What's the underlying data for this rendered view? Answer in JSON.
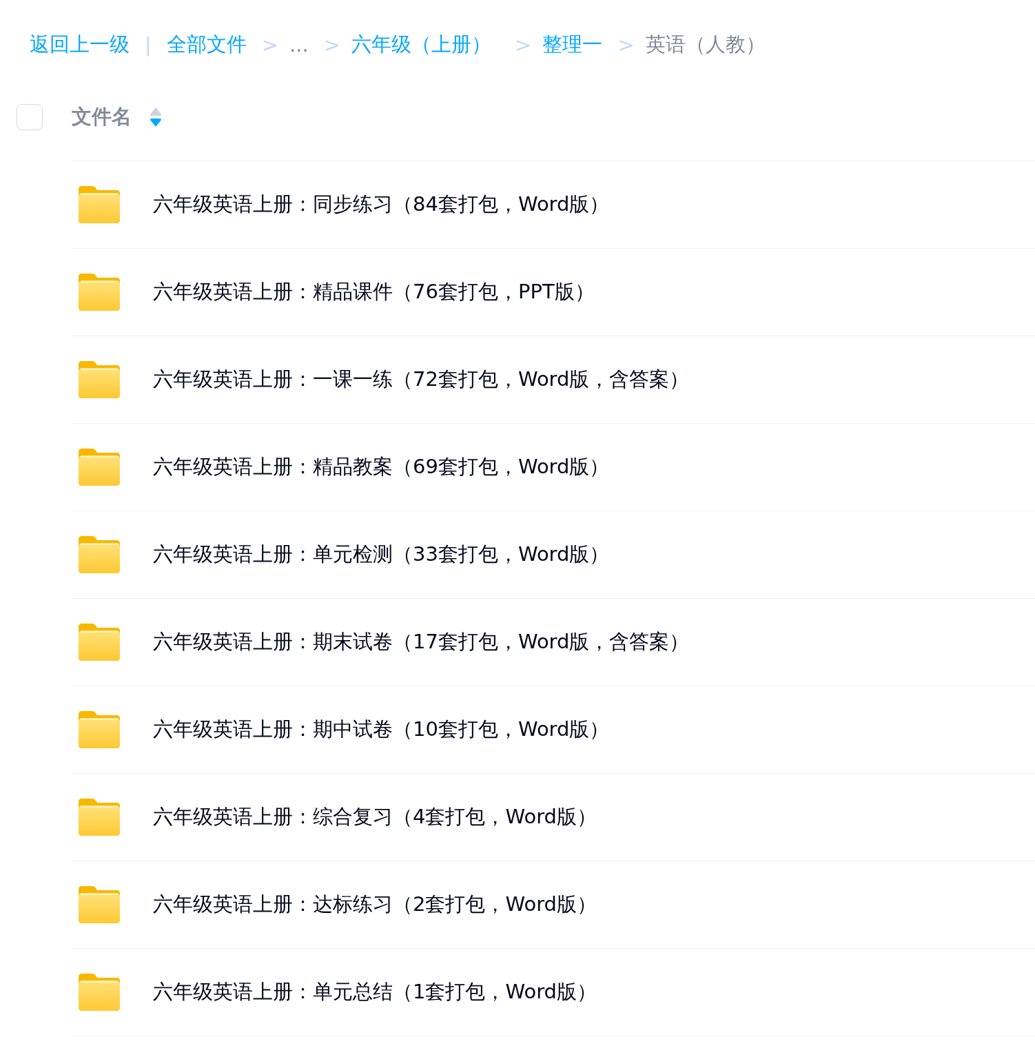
{
  "breadcrumb": [
    {
      "kind": "link",
      "text": "返回上一级"
    },
    {
      "kind": "divider",
      "text": "|"
    },
    {
      "kind": "link",
      "text": "全部文件"
    },
    {
      "kind": "arrow",
      "text": ">"
    },
    {
      "kind": "ellipsis",
      "text": "..."
    },
    {
      "kind": "arrow",
      "text": ">"
    },
    {
      "kind": "link",
      "text": "六年级（上册）"
    },
    {
      "kind": "arrow",
      "text": ">"
    },
    {
      "kind": "link",
      "text": "整理一"
    },
    {
      "kind": "arrow",
      "text": ">"
    },
    {
      "kind": "current",
      "text": "英语（人教）"
    }
  ],
  "header": {
    "checked": false,
    "column": "文件名",
    "sort_descending": true
  },
  "files": [
    {
      "kind": "folder",
      "name": "六年级英语上册：同步练习（84套打包，Word版）"
    },
    {
      "kind": "folder",
      "name": "六年级英语上册：精品课件（76套打包，PPT版）"
    },
    {
      "kind": "folder",
      "name": "六年级英语上册：一课一练（72套打包，Word版，含答案）"
    },
    {
      "kind": "folder",
      "name": "六年级英语上册：精品教案（69套打包，Word版）"
    },
    {
      "kind": "folder",
      "name": "六年级英语上册：单元检测（33套打包，Word版）"
    },
    {
      "kind": "folder",
      "name": "六年级英语上册：期末试卷（17套打包，Word版，含答案）"
    },
    {
      "kind": "folder",
      "name": "六年级英语上册：期中试卷（10套打包，Word版）"
    },
    {
      "kind": "folder",
      "name": "六年级英语上册：综合复习（4套打包，Word版）"
    },
    {
      "kind": "folder",
      "name": "六年级英语上册：达标练习（2套打包，Word版）"
    },
    {
      "kind": "folder",
      "name": "六年级英语上册：单元总结（1套打包，Word版）"
    }
  ]
}
